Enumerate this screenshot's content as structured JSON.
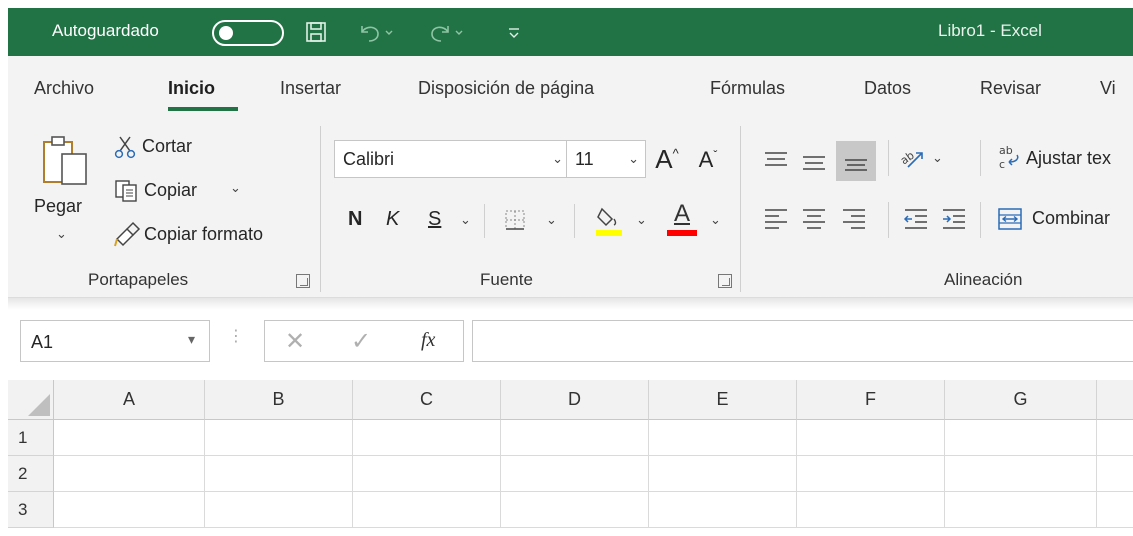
{
  "titlebar": {
    "autosave_label": "Autoguardado",
    "autosave_state": "off",
    "doc_title": "Libro1  -  Excel",
    "brand_color": "#217346"
  },
  "tabs": [
    {
      "label": "Archivo",
      "active": false
    },
    {
      "label": "Inicio",
      "active": true
    },
    {
      "label": "Insertar",
      "active": false
    },
    {
      "label": "Disposición de página",
      "active": false
    },
    {
      "label": "Fórmulas",
      "active": false
    },
    {
      "label": "Datos",
      "active": false
    },
    {
      "label": "Revisar",
      "active": false
    },
    {
      "label": "Vi",
      "active": false
    }
  ],
  "clipboard": {
    "paste_label": "Pegar",
    "cut_label": "Cortar",
    "copy_label": "Copiar",
    "format_painter_label": "Copiar formato",
    "group_label": "Portapapeles"
  },
  "font": {
    "font_name": "Calibri",
    "font_size": "11",
    "bold_label": "N",
    "italic_label": "K",
    "underline_label": "S",
    "font_color_label": "A",
    "highlight_color": "#ffff00",
    "font_color": "#ff0000",
    "group_label": "Fuente"
  },
  "alignment": {
    "wrap_text_label": "Ajustar tex",
    "merge_label": "Combinar",
    "group_label": "Alineación"
  },
  "formula_bar": {
    "name_box_value": "A1",
    "fx_label": "fx",
    "formula_value": ""
  },
  "grid": {
    "columns": [
      "A",
      "B",
      "C",
      "D",
      "E",
      "F",
      "G"
    ],
    "rows": [
      "1",
      "2",
      "3"
    ]
  }
}
